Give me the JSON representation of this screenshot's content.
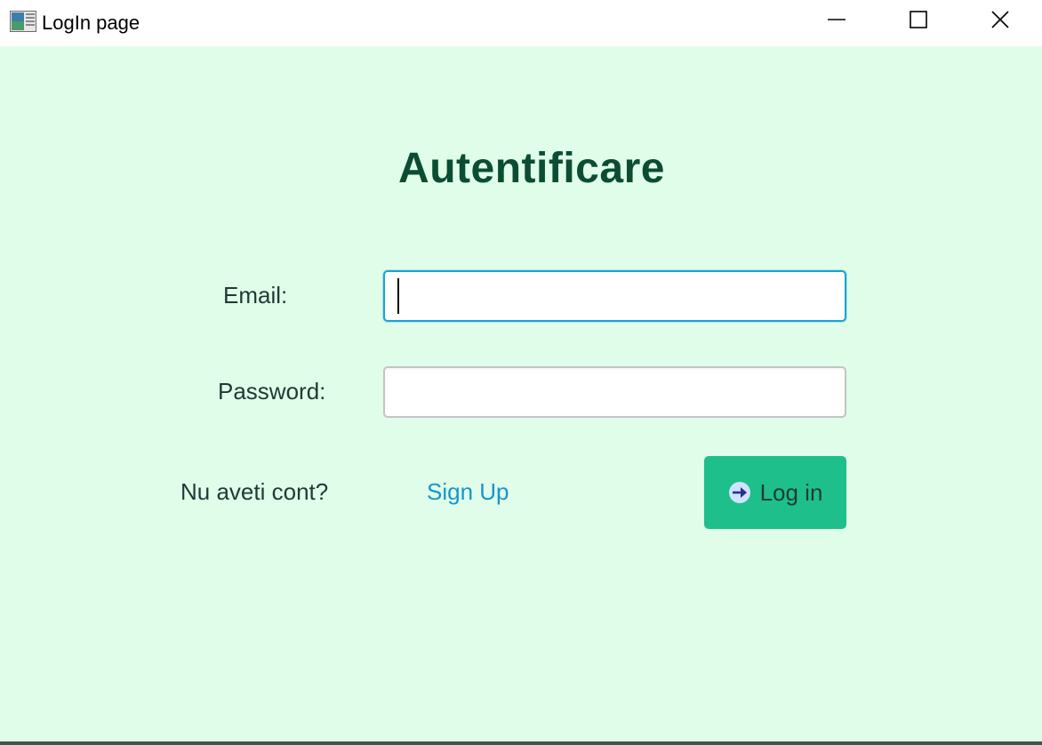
{
  "window": {
    "title": "LogIn page",
    "icons": {
      "app": "app-window-icon",
      "minimize": "minimize-icon",
      "maximize": "maximize-icon",
      "close": "close-icon"
    }
  },
  "form": {
    "heading": "Autentificare",
    "email": {
      "label": "Email:",
      "value": "",
      "placeholder": ""
    },
    "password": {
      "label": "Password:",
      "value": "",
      "placeholder": ""
    },
    "no_account_text": "Nu aveti cont?",
    "signup_label": "Sign Up",
    "login_button": {
      "label": "Log in",
      "icon": "arrow-circle-right-icon"
    }
  },
  "colors": {
    "background": "#e0fde9",
    "heading": "#0b4d33",
    "link": "#1696c9",
    "button": "#1ebf8b",
    "focus_border": "#1aa3d6"
  }
}
